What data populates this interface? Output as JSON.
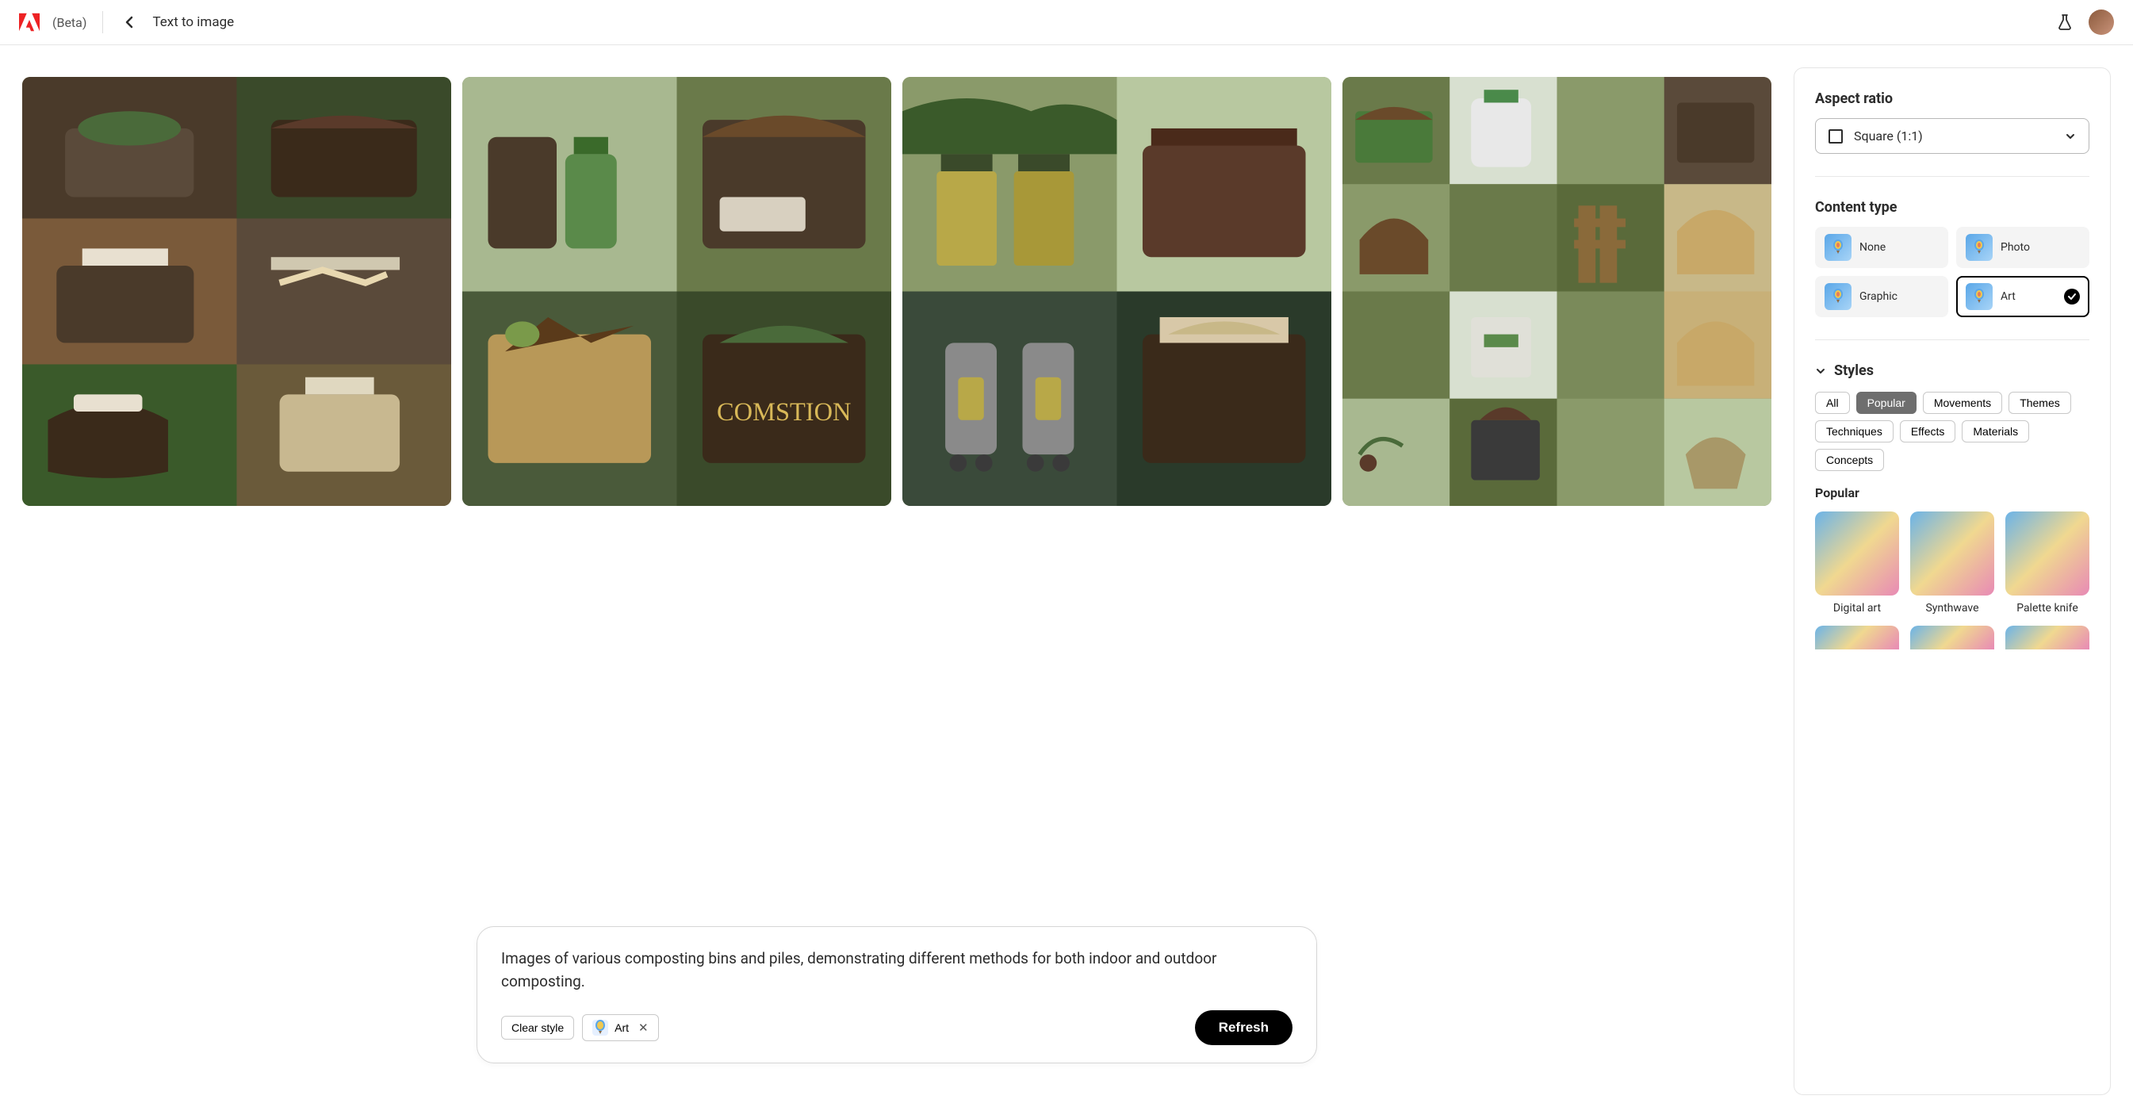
{
  "header": {
    "beta": "(Beta)",
    "title": "Text to image"
  },
  "prompt": {
    "text": "Images of various composting bins and piles, demonstrating different methods for both indoor and outdoor composting.",
    "clear_style": "Clear style",
    "style_chip": "Art",
    "refresh": "Refresh"
  },
  "sidebar": {
    "aspect_ratio": {
      "title": "Aspect ratio",
      "value": "Square (1:1)"
    },
    "content_type": {
      "title": "Content type",
      "items": [
        {
          "label": "None",
          "selected": false
        },
        {
          "label": "Photo",
          "selected": false
        },
        {
          "label": "Graphic",
          "selected": false
        },
        {
          "label": "Art",
          "selected": true
        }
      ]
    },
    "styles": {
      "title": "Styles",
      "filters": [
        "All",
        "Popular",
        "Movements",
        "Themes",
        "Techniques",
        "Effects",
        "Materials",
        "Concepts"
      ],
      "active_filter": "Popular",
      "section_label": "Popular",
      "items": [
        "Digital art",
        "Synthwave",
        "Palette knife"
      ]
    }
  }
}
